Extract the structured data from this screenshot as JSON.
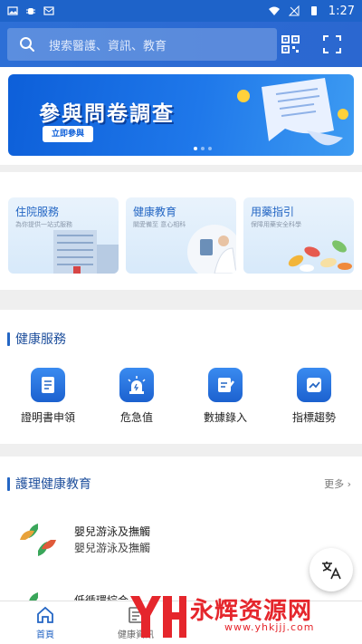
{
  "status_bar": {
    "time": "1:27"
  },
  "search": {
    "placeholder": "搜索醫護、資訊、教育"
  },
  "banner": {
    "title": "參與問卷調查",
    "button": "立即參與"
  },
  "cards": [
    {
      "title": "住院服務",
      "subtitle": "為你提供一站式服務"
    },
    {
      "title": "健康教育",
      "subtitle": "關愛備至 意心相科"
    },
    {
      "title": "用藥指引",
      "subtitle": "保障用藥安全科學"
    }
  ],
  "health_services": {
    "title": "健康服務",
    "items": [
      {
        "label": "證明書申領",
        "icon": "certificate-icon"
      },
      {
        "label": "危急值",
        "icon": "alarm-light-icon"
      },
      {
        "label": "數據錄入",
        "icon": "data-entry-icon"
      },
      {
        "label": "指標趨勢",
        "icon": "trend-chart-icon"
      }
    ]
  },
  "education": {
    "title": "護理健康教育",
    "more": "更多",
    "items": [
      {
        "title": "嬰兒游泳及撫觸",
        "subtitle": "嬰兒游泳及撫觸"
      },
      {
        "title": "低循環綜合"
      }
    ]
  },
  "tabs": [
    {
      "label": "首頁",
      "icon": "home-icon",
      "active": true
    },
    {
      "label": "健康資訊",
      "icon": "news-icon",
      "active": false
    }
  ],
  "watermark": {
    "text": "永辉资源网",
    "url": "www.yhkjjj.com"
  },
  "colors": {
    "primary": "#2466c4",
    "topbar": "#2d6fd6",
    "watermark": "#e5262c"
  }
}
